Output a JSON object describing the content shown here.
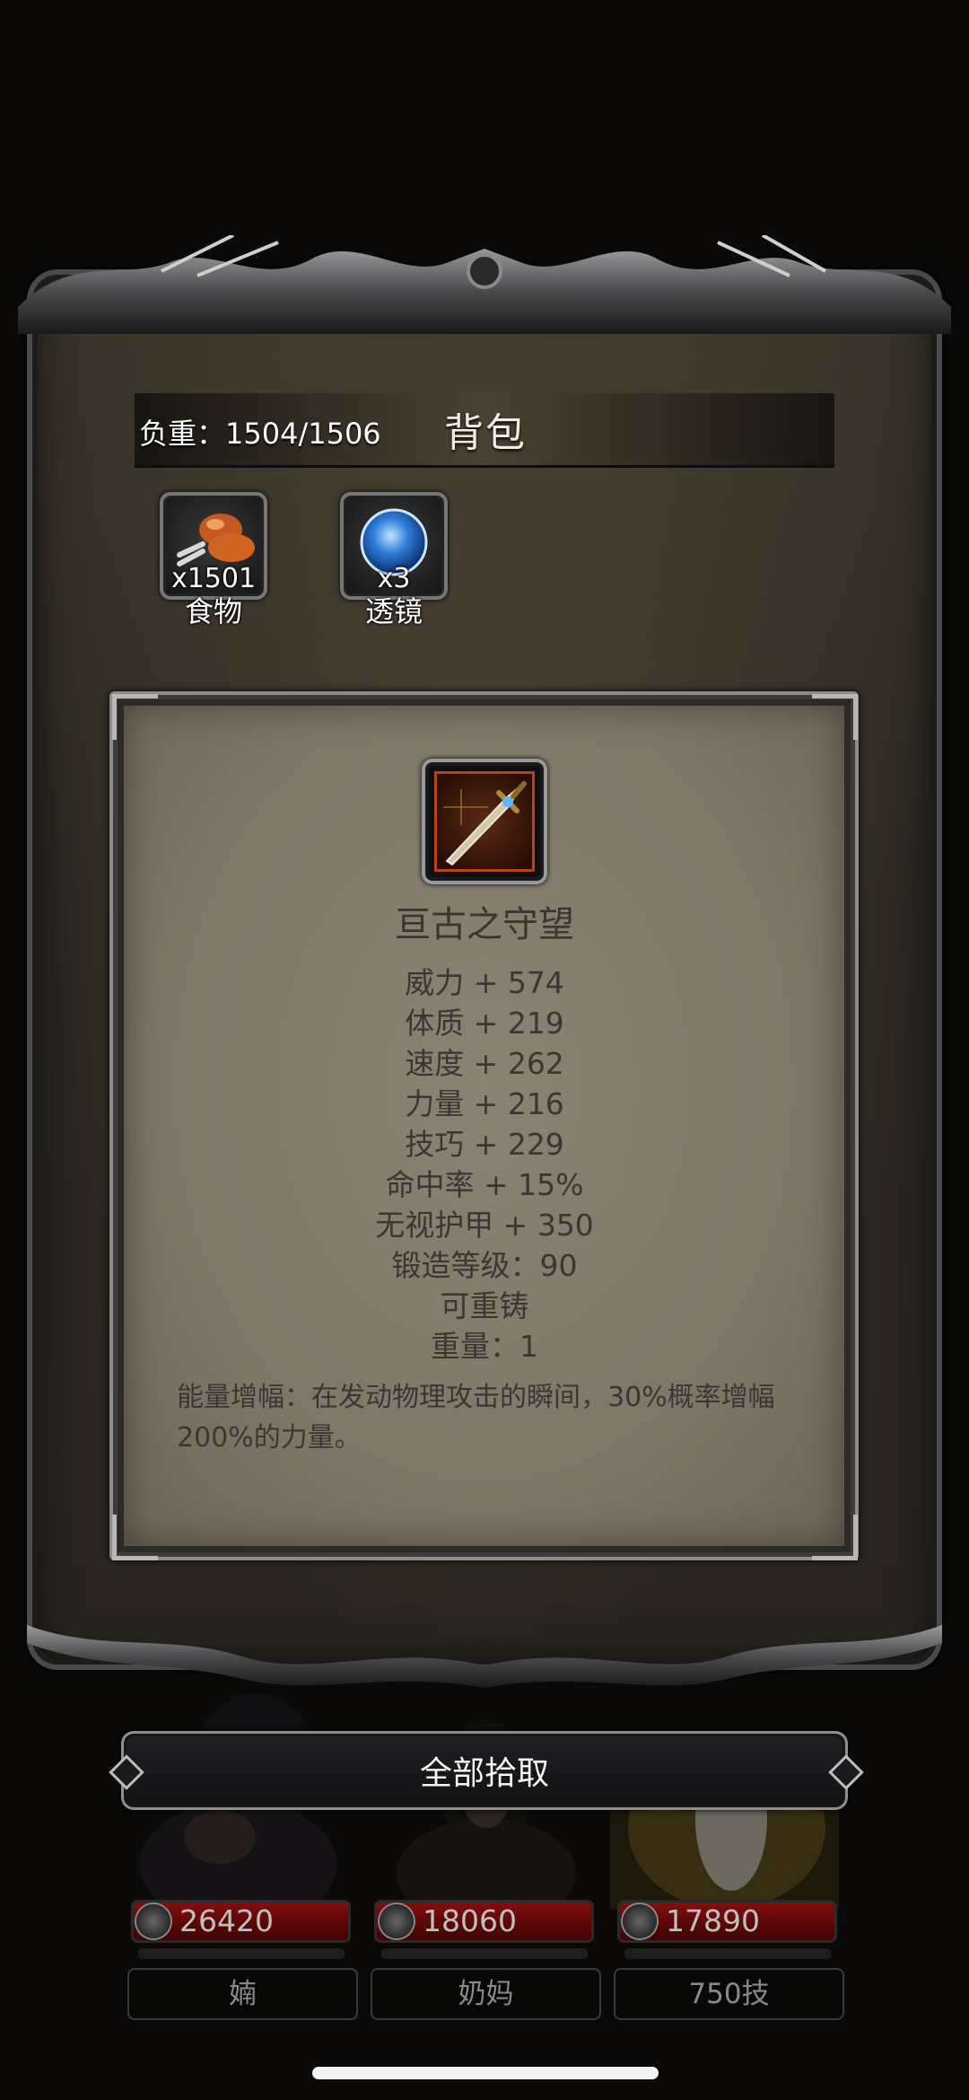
{
  "bag": {
    "weight_label": "负重：1504/1506",
    "title": "背包",
    "items": [
      {
        "name": "食物",
        "count": "x1501",
        "icon": "food-meat-icon"
      },
      {
        "name": "透镜",
        "count": "x3",
        "icon": "blue-orb-lens-icon"
      }
    ]
  },
  "detail": {
    "icon": "sword-icon",
    "name": "亘古之守望",
    "stats": [
      "威力 + 574",
      "体质 + 219",
      "速度 + 262",
      "力量 + 216",
      "技巧 + 229",
      "命中率 + 15%",
      "无视护甲 + 350",
      "锻造等级：90",
      "可重铸",
      "重量：1"
    ],
    "description": "能量增幅：在发动物理攻击的瞬间，30%概率增幅200%的力量。"
  },
  "pickup_all_label": "全部拾取",
  "party": [
    {
      "hp": "26420",
      "name": "婻"
    },
    {
      "hp": "18060",
      "name": "奶妈"
    },
    {
      "hp": "17890",
      "name": "750技"
    }
  ],
  "colors": {
    "panel_parchment": "#8a8272",
    "hp_bar_red": "#8a1010",
    "text_dark": "#3a3733"
  }
}
